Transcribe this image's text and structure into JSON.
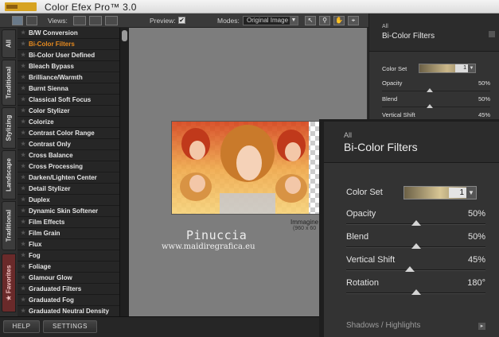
{
  "app": {
    "title": "Color Efex Pro™ 3.0"
  },
  "toolbar": {
    "views_label": "Views:",
    "preview_label": "Preview:",
    "preview_checked": "✔",
    "modes_label": "Modes:",
    "mode_value": "Original Image"
  },
  "tabs": [
    "All",
    "Traditional",
    "Stylizing",
    "Landscape",
    "Traditional",
    "★ Favorites"
  ],
  "filters": [
    {
      "label": "B/W Conversion"
    },
    {
      "label": "Bi-Color Filters"
    },
    {
      "label": "Bi-Color User Defined"
    },
    {
      "label": "Bleach Bypass"
    },
    {
      "label": "Brilliance/Warmth"
    },
    {
      "label": "Burnt Sienna"
    },
    {
      "label": "Classical Soft Focus"
    },
    {
      "label": "Color Stylizer"
    },
    {
      "label": "Colorize"
    },
    {
      "label": "Contrast Color Range"
    },
    {
      "label": "Contrast Only"
    },
    {
      "label": "Cross Balance"
    },
    {
      "label": "Cross Processing"
    },
    {
      "label": "Darken/Lighten Center"
    },
    {
      "label": "Detail Stylizer"
    },
    {
      "label": "Duplex"
    },
    {
      "label": "Dynamic Skin Softener"
    },
    {
      "label": "Film Effects"
    },
    {
      "label": "Film Grain"
    },
    {
      "label": "Flux"
    },
    {
      "label": "Fog"
    },
    {
      "label": "Foliage"
    },
    {
      "label": "Glamour Glow"
    },
    {
      "label": "Graduated Filters"
    },
    {
      "label": "Graduated Fog"
    },
    {
      "label": "Graduated Neutral Density"
    }
  ],
  "active_filter_index": 1,
  "preview": {
    "caption": "Immagine",
    "dims": "(960 x 60",
    "watermark_name": "Pinuccia",
    "watermark_url": "www.maidiregrafica.eu"
  },
  "panel": {
    "category": "All",
    "name": "Bi-Color Filters",
    "color_set_label": "Color Set",
    "color_set_value": "1",
    "opacity_label": "Opacity",
    "opacity_value": "50%",
    "opacity_level": 0.5,
    "blend_label": "Blend",
    "blend_value": "50%",
    "blend_level": 0.5,
    "vshift_label": "Vertical Shift",
    "vshift_value": "45%",
    "vshift_level": 0.45,
    "rotation_label": "Rotation",
    "rotation_value": "180°",
    "rotation_level": 0.5,
    "section_label": "Shadows / Highlights"
  },
  "bottom": {
    "help": "HELP",
    "settings": "SETTINGS"
  }
}
